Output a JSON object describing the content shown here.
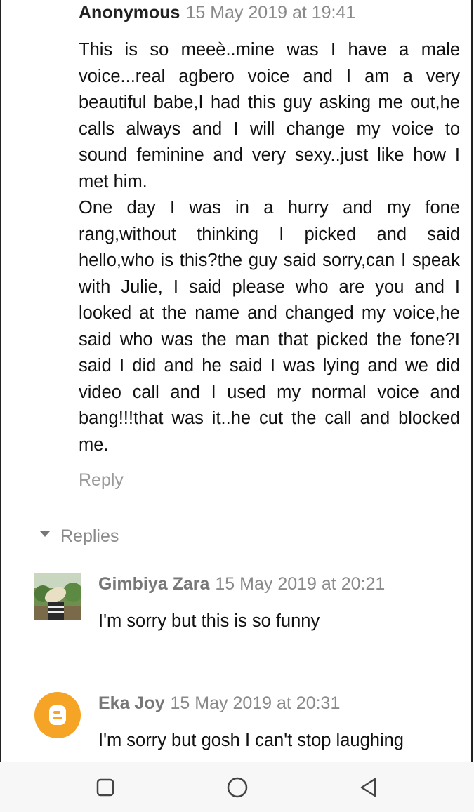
{
  "comment": {
    "author": "Anonymous",
    "timestamp": "15 May 2019 at 19:41",
    "paragraphs": [
      "This is so meeè..mine was I have a male voice...real agbero voice and I am a very beautiful babe,I had this guy asking me out,he calls always and I will change my voice to sound feminine and very sexy..just like how I met him.",
      "One day I was in a hurry and my fone rang,without thinking I picked and said hello,who is this?the guy said sorry,can I speak with Julie, I said please who are you and I looked at the name and changed my voice,he said who was the man that picked the fone?I said I did and he said I was lying and we did video call and I used my normal voice and bang!!!that was it..he cut the call and blocked me."
    ],
    "reply_label": "Reply"
  },
  "replies": {
    "toggle_label": "Replies",
    "items": [
      {
        "author": "Gimbiya Zara",
        "timestamp": "15 May 2019 at 20:21",
        "text": "I'm sorry but this is so funny",
        "avatar": "photo-avatar"
      },
      {
        "author": "Eka Joy",
        "timestamp": "15 May 2019 at 20:31",
        "text": "I'm sorry but gosh I can't stop laughing",
        "avatar": "blogger-icon"
      }
    ]
  },
  "navbar": {
    "icons": [
      "recent-apps-icon",
      "home-icon",
      "back-icon"
    ],
    "background": "#f7f7f7"
  },
  "colors": {
    "accent_blogger": "#f5a425",
    "timestamp_gray": "#8a8a8a"
  }
}
